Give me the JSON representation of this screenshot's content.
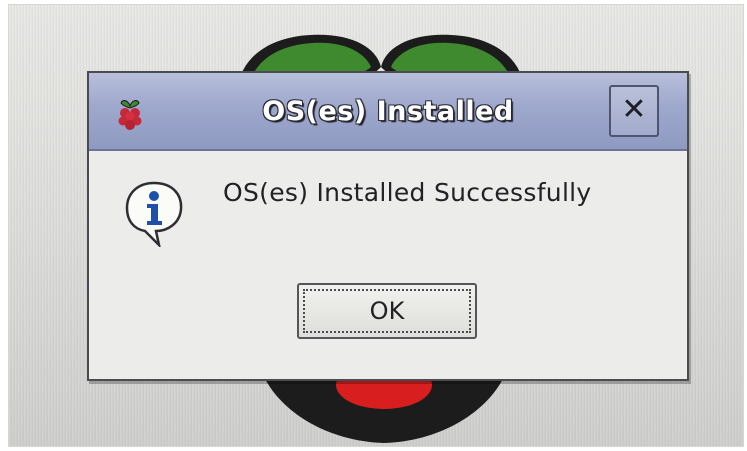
{
  "dialog": {
    "title": "OS(es) Installed",
    "close_label": "✕",
    "message": "OS(es) Installed Successfully",
    "ok_label": "OK"
  },
  "icons": {
    "title": "raspberry-icon",
    "message": "info-icon",
    "close": "close-icon"
  },
  "colors": {
    "titlebar": "#9ea8cc",
    "dialog_body": "#ececea",
    "leaf_green": "#3f8a2e",
    "berry_red": "#d81e1e"
  }
}
